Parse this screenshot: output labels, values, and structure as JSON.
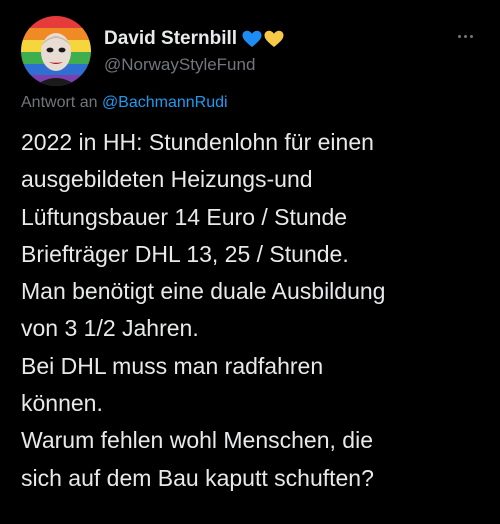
{
  "author": {
    "display_name": "David Sternbill",
    "badges": [
      "blue-heart-icon",
      "yellow-heart-icon"
    ],
    "handle": "@NorwayStyleFund",
    "avatar": "avatar-rainbow-portrait"
  },
  "reply": {
    "prefix": "Antwort an",
    "mention": "@BachmannRudi"
  },
  "tweet": {
    "lines": [
      "2022 in HH: Stundenlohn für einen",
      "ausgebildeten Heizungs-und",
      "Lüftungsbauer 14 Euro / Stunde",
      "Briefträger DHL 13, 25 / Stunde.",
      "Man benötigt eine duale Ausbildung",
      "von 3 1/2 Jahren.",
      "Bei DHL muss man radfahren",
      "können.",
      "Warum fehlen wohl Menschen, die",
      "sich auf dem Bau kaputt schuften?"
    ]
  },
  "colors": {
    "background": "#000000",
    "text": "#e7e9ea",
    "secondary": "#71767b",
    "link": "#1d9bf0",
    "blue_heart": "#1d8df5",
    "yellow_heart": "#f7c948"
  }
}
